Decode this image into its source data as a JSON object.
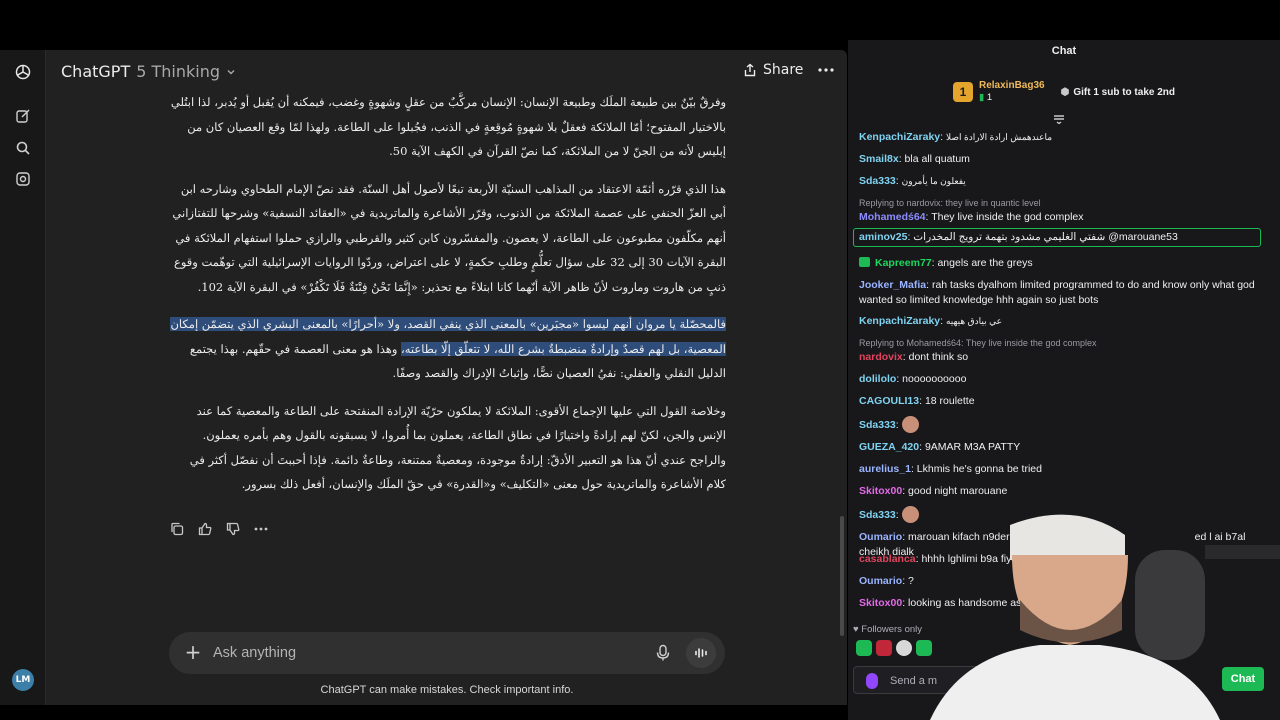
{
  "gpt": {
    "model_name": "ChatGPT",
    "model_variant": "5 Thinking",
    "share_label": "Share",
    "user_initials": "LM",
    "paragraphs": [
      "وفرقٌ بيّنٌ بين طبيعة الملَك وطبيعة الإنسان: الإنسان مركَّبٌ من عقلٍ وشهوةٍ وغضب، فيمكنه أن يُقبل أو يُدبر، لذا ابتُلي بالاختيار المفتوح؛ أمّا الملائكة فعقلٌ بلا شهوةٍ مُوقِعةٍ في الذنب، فجُبلوا على الطاعة. ولهذا لمّا وقع العصيان كان من إبليس لأنه من الجنّ لا من الملائكة، كما نصّ القرآن في الكهف الآية 50.",
      "هذا الذي قرّره أئمّة الاعتقاد من المذاهب السنيّة الأربعة تبعًا لأصول أهل السنّة. فقد نصّ الإمام الطحاوي وشارحه ابن أبي العزّ الحنفي على عصمة الملائكة من الذنوب، وقرّر الأشاعرة والماتريدية في «العقائد النسفية» وشرحها للتفتازاني أنهم مكلّفون مطبوعون على الطاعة، لا يعصون. والمفسّرون كابن كثير والقرطبي والرازي حملوا استفهام الملائكة في البقرة الآيات 30 إلى 32 على سؤال تعلُّمٍ وطلبِ حكمةٍ، لا على اعتراض، وردّوا الروايات الإسرائيلية التي توهّمت وقوع ذنبٍ من هاروت وماروت لأنّ ظاهر الآية أنّهما كانا ابتلاءً مع تحذير: «إِنَّمَا نَحْنُ فِتْنَةٌ فَلَا تَكْفُرْ» في البقرة الآية 102."
    ],
    "highlighted_paragraph": {
      "highlighted": "فالمحصّلة يا مروان أنهم ليسوا «مجبَرين» بالمعنى الذي ينفي القصد، ولا «أحرارًا» بالمعنى البشري الذي يتضمّن إمكان المعصية، بل لهم قصدٌ وإرادةٌ منضبطةٌ بشرع الله، لا تتعلّق إلّا بطاعته،",
      "rest": " وهذا هو معنى العصمة في حقّهم. بهذا يجتمع الدليل النقلي والعقلي: نفيُ العصيان نصًّا، وإثباتُ الإدراك والقصد وصفًا."
    },
    "conclusion": "وخلاصة القول التي عليها الإجماع الأقوى: الملائكة لا يملكون حرّيّة الإرادة المنفتحة على الطاعة والمعصية كما عند الإنس والجن، لكنّ لهم إرادةً واختيارًا في نطاق الطاعة، يعملون بما أُمروا، لا يسبقونه بالقول وهم بأمره يعملون. والراجح عندي أنّ هذا هو التعبير الأدقّ: إرادةٌ موجودة، ومعصيةٌ ممتنعة، وطاعةٌ دائمة. فإذا أحببتَ أن نفصّل أكثر في كلام الأشاعرة والماتريدية حول معنى «التكليف» و«القدرة» في حقّ الملَك والإنسان، أفعل ذلك بسرور.",
    "composer_placeholder": "Ask anything",
    "disclaimer": "ChatGPT can make mistakes. Check important info.",
    "icons": [
      "openai-logo-icon",
      "new-chat-icon",
      "search-icon",
      "library-icon",
      "share-icon",
      "more-icon",
      "copy-icon",
      "thumbs-up-icon",
      "thumbs-down-icon",
      "plus-icon",
      "mic-icon",
      "voice-mode-icon"
    ]
  },
  "chat": {
    "header": "Chat",
    "gift": {
      "badge": "1",
      "username": "RelaxinBag36",
      "gift_count": "1",
      "cta": "Gift 1 sub to take 2nd"
    },
    "messages": [
      {
        "user": "KenpachiZaraky",
        "color": "#7fd3f0",
        "text": "ماعندهمش ارادة الارادة اصلا",
        "small": true
      },
      {
        "user": "Smail8x",
        "color": "#7fd3f0",
        "text": "bla all quatum"
      },
      {
        "user": "Sda333",
        "color": "#7fd3f0",
        "text": "يفعلون ما يأمرون",
        "small": true
      },
      {
        "reply": "Replying to nardovix: they live in quantic level"
      },
      {
        "user": "Mohamedś64",
        "color": "#8c8cff",
        "text": "They live inside the god complex"
      },
      {
        "user": "aminov25",
        "color": "#7fd3f0",
        "text": "شفتي الغليمي مشدود بتهمة ترويج المخدرات @marouane53",
        "mention": true
      },
      {
        "user": "Kapreem77",
        "color": "#1ed760",
        "text": "angels are the greys",
        "sub": true
      },
      {
        "user": "Jooker_Mafia",
        "color": "#9ab4ff",
        "text": "rah tasks dyalhom limited programmed to do and know only what god wanted so limited knowledge hhh again so just bots"
      },
      {
        "user": "KenpachiZaraky",
        "color": "#7fd3f0",
        "text": "عي بيادق هيهيه",
        "small": true
      },
      {
        "reply": "Replying to Mohamedś64: They live inside the god complex"
      },
      {
        "user": "nardovix",
        "color": "#e0445e",
        "text": "dont think so"
      },
      {
        "user": "dolilolo",
        "color": "#7fd3f0",
        "text": "noooooooooo"
      },
      {
        "user": "CAGOULI13",
        "color": "#7fd3f0",
        "text": "18 roulette"
      },
      {
        "user": "Sda333",
        "color": "#7fd3f0",
        "text": "",
        "emote": true
      },
      {
        "user": "GUEZA_420",
        "color": "#7fd3f0",
        "text": "9AMAR M3A PATTY"
      },
      {
        "user": "aurelius_1",
        "color": "#9ab4ff",
        "text": "Lkhmis he's gonna be tried"
      },
      {
        "user": "Skitox00",
        "color": "#e36be8",
        "text": "good night marouane"
      },
      {
        "user": "Sda333",
        "color": "#7fd3f0",
        "text": "",
        "emote": true
      },
      {
        "user": "Oumario",
        "color": "#9ab4ff",
        "text": "marouan kifach n9der ndir ap",
        "tail": "ed l ai b7al cheikh dialk"
      },
      {
        "user": "casablanca",
        "color": "#e0445e",
        "text": "hhhh lghlimi b9a fiya mes"
      },
      {
        "user": "Oumario",
        "color": "#9ab4ff",
        "text": "?"
      },
      {
        "user": "Skitox00",
        "color": "#e36be8",
        "text": "looking as handsome as alw"
      }
    ],
    "followers_only": "Followers only",
    "input_placeholder": "Send a m",
    "send_label": "Chat"
  }
}
